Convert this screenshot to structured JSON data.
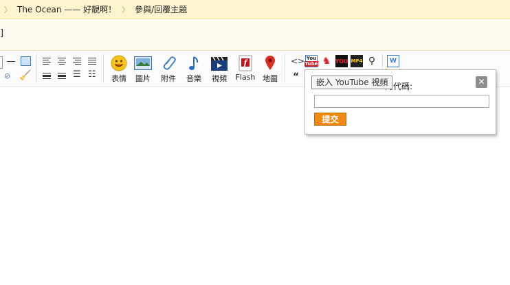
{
  "breadcrumb": {
    "items": [
      "The Ocean —— 好靚啊！",
      "參與/回覆主題"
    ]
  },
  "title": {
    "bracket": "]"
  },
  "toolbar": {
    "buttons": [
      {
        "label": "表情",
        "icon": "smiley-icon"
      },
      {
        "label": "圖片",
        "icon": "image-icon"
      },
      {
        "label": "附件",
        "icon": "paperclip-icon"
      },
      {
        "label": "音樂",
        "icon": "music-note-icon"
      },
      {
        "label": "視頻",
        "icon": "video-clapper-icon"
      },
      {
        "label": "Flash",
        "icon": "flash-icon"
      },
      {
        "label": "地圖",
        "icon": "map-pin-icon"
      }
    ],
    "code_symbol": "<>",
    "quote_symbol": "“",
    "mini_icons": [
      "YouTube",
      "Tudou",
      "YOU",
      "MP4",
      "search"
    ]
  },
  "popup": {
    "label": "的代碼:",
    "input_value": "",
    "submit_label": "提交",
    "close_symbol": "✕"
  },
  "tooltip": {
    "text": "嵌入 YouTube 視頻"
  }
}
